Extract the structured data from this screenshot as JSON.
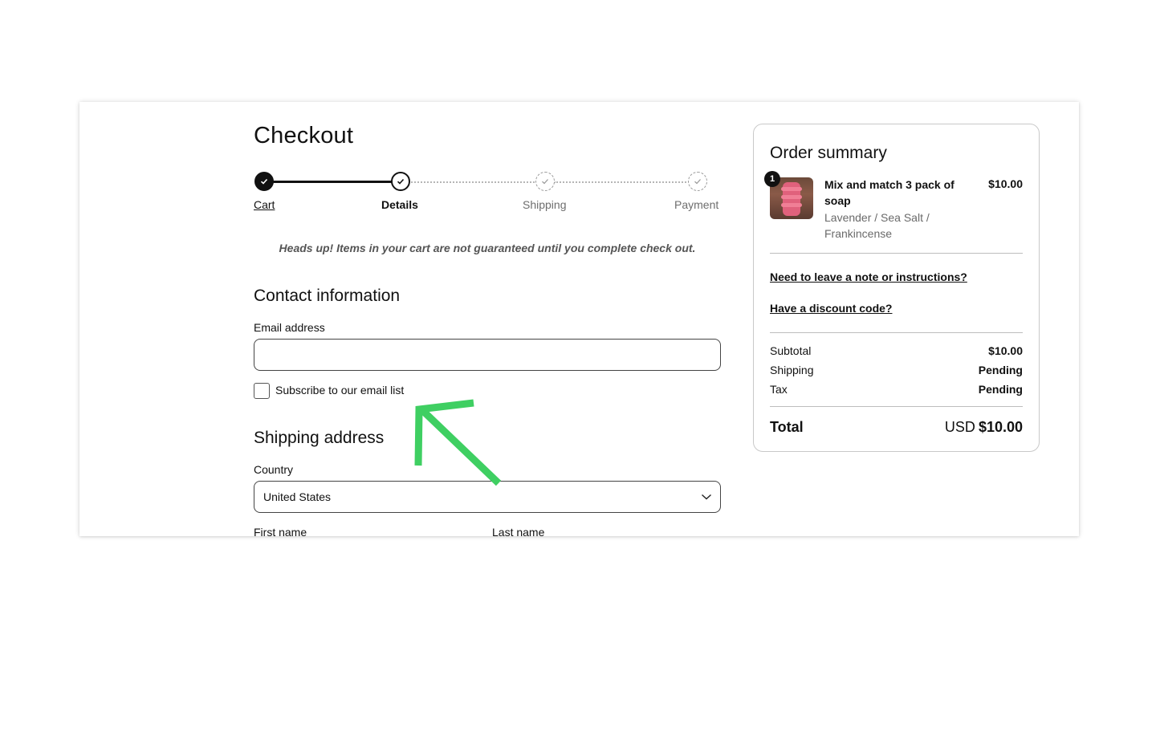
{
  "checkout": {
    "title": "Checkout",
    "steps": [
      {
        "label": "Cart",
        "state": "done"
      },
      {
        "label": "Details",
        "state": "active"
      },
      {
        "label": "Shipping",
        "state": "pending"
      },
      {
        "label": "Payment",
        "state": "pending"
      }
    ],
    "notice": "Heads up! Items in your cart are not guaranteed until you complete check out."
  },
  "contact": {
    "heading": "Contact information",
    "email_label": "Email address",
    "email_value": "",
    "subscribe_label": "Subscribe to our email list",
    "subscribe_checked": false
  },
  "shipping": {
    "heading": "Shipping address",
    "country_label": "Country",
    "country_value": "United States",
    "first_name_label": "First name",
    "last_name_label": "Last name"
  },
  "summary": {
    "title": "Order summary",
    "item": {
      "quantity": "1",
      "name": "Mix and match 3 pack of soap",
      "variant": "Lavender / Sea Salt / Frankincense",
      "price": "$10.00"
    },
    "note_link": "Need to leave a note or instructions?",
    "discount_link": "Have a discount code?",
    "rows": [
      {
        "label": "Subtotal",
        "value": "$10.00"
      },
      {
        "label": "Shipping",
        "value": "Pending"
      },
      {
        "label": "Tax",
        "value": "Pending"
      }
    ],
    "total_label": "Total",
    "total_currency": "USD",
    "total_amount": "$10.00"
  },
  "annotation": {
    "arrow_color": "#3fcf62"
  },
  "colors": {
    "text": "#111111",
    "muted": "#6a6a6a",
    "border": "#c9c9c9"
  }
}
